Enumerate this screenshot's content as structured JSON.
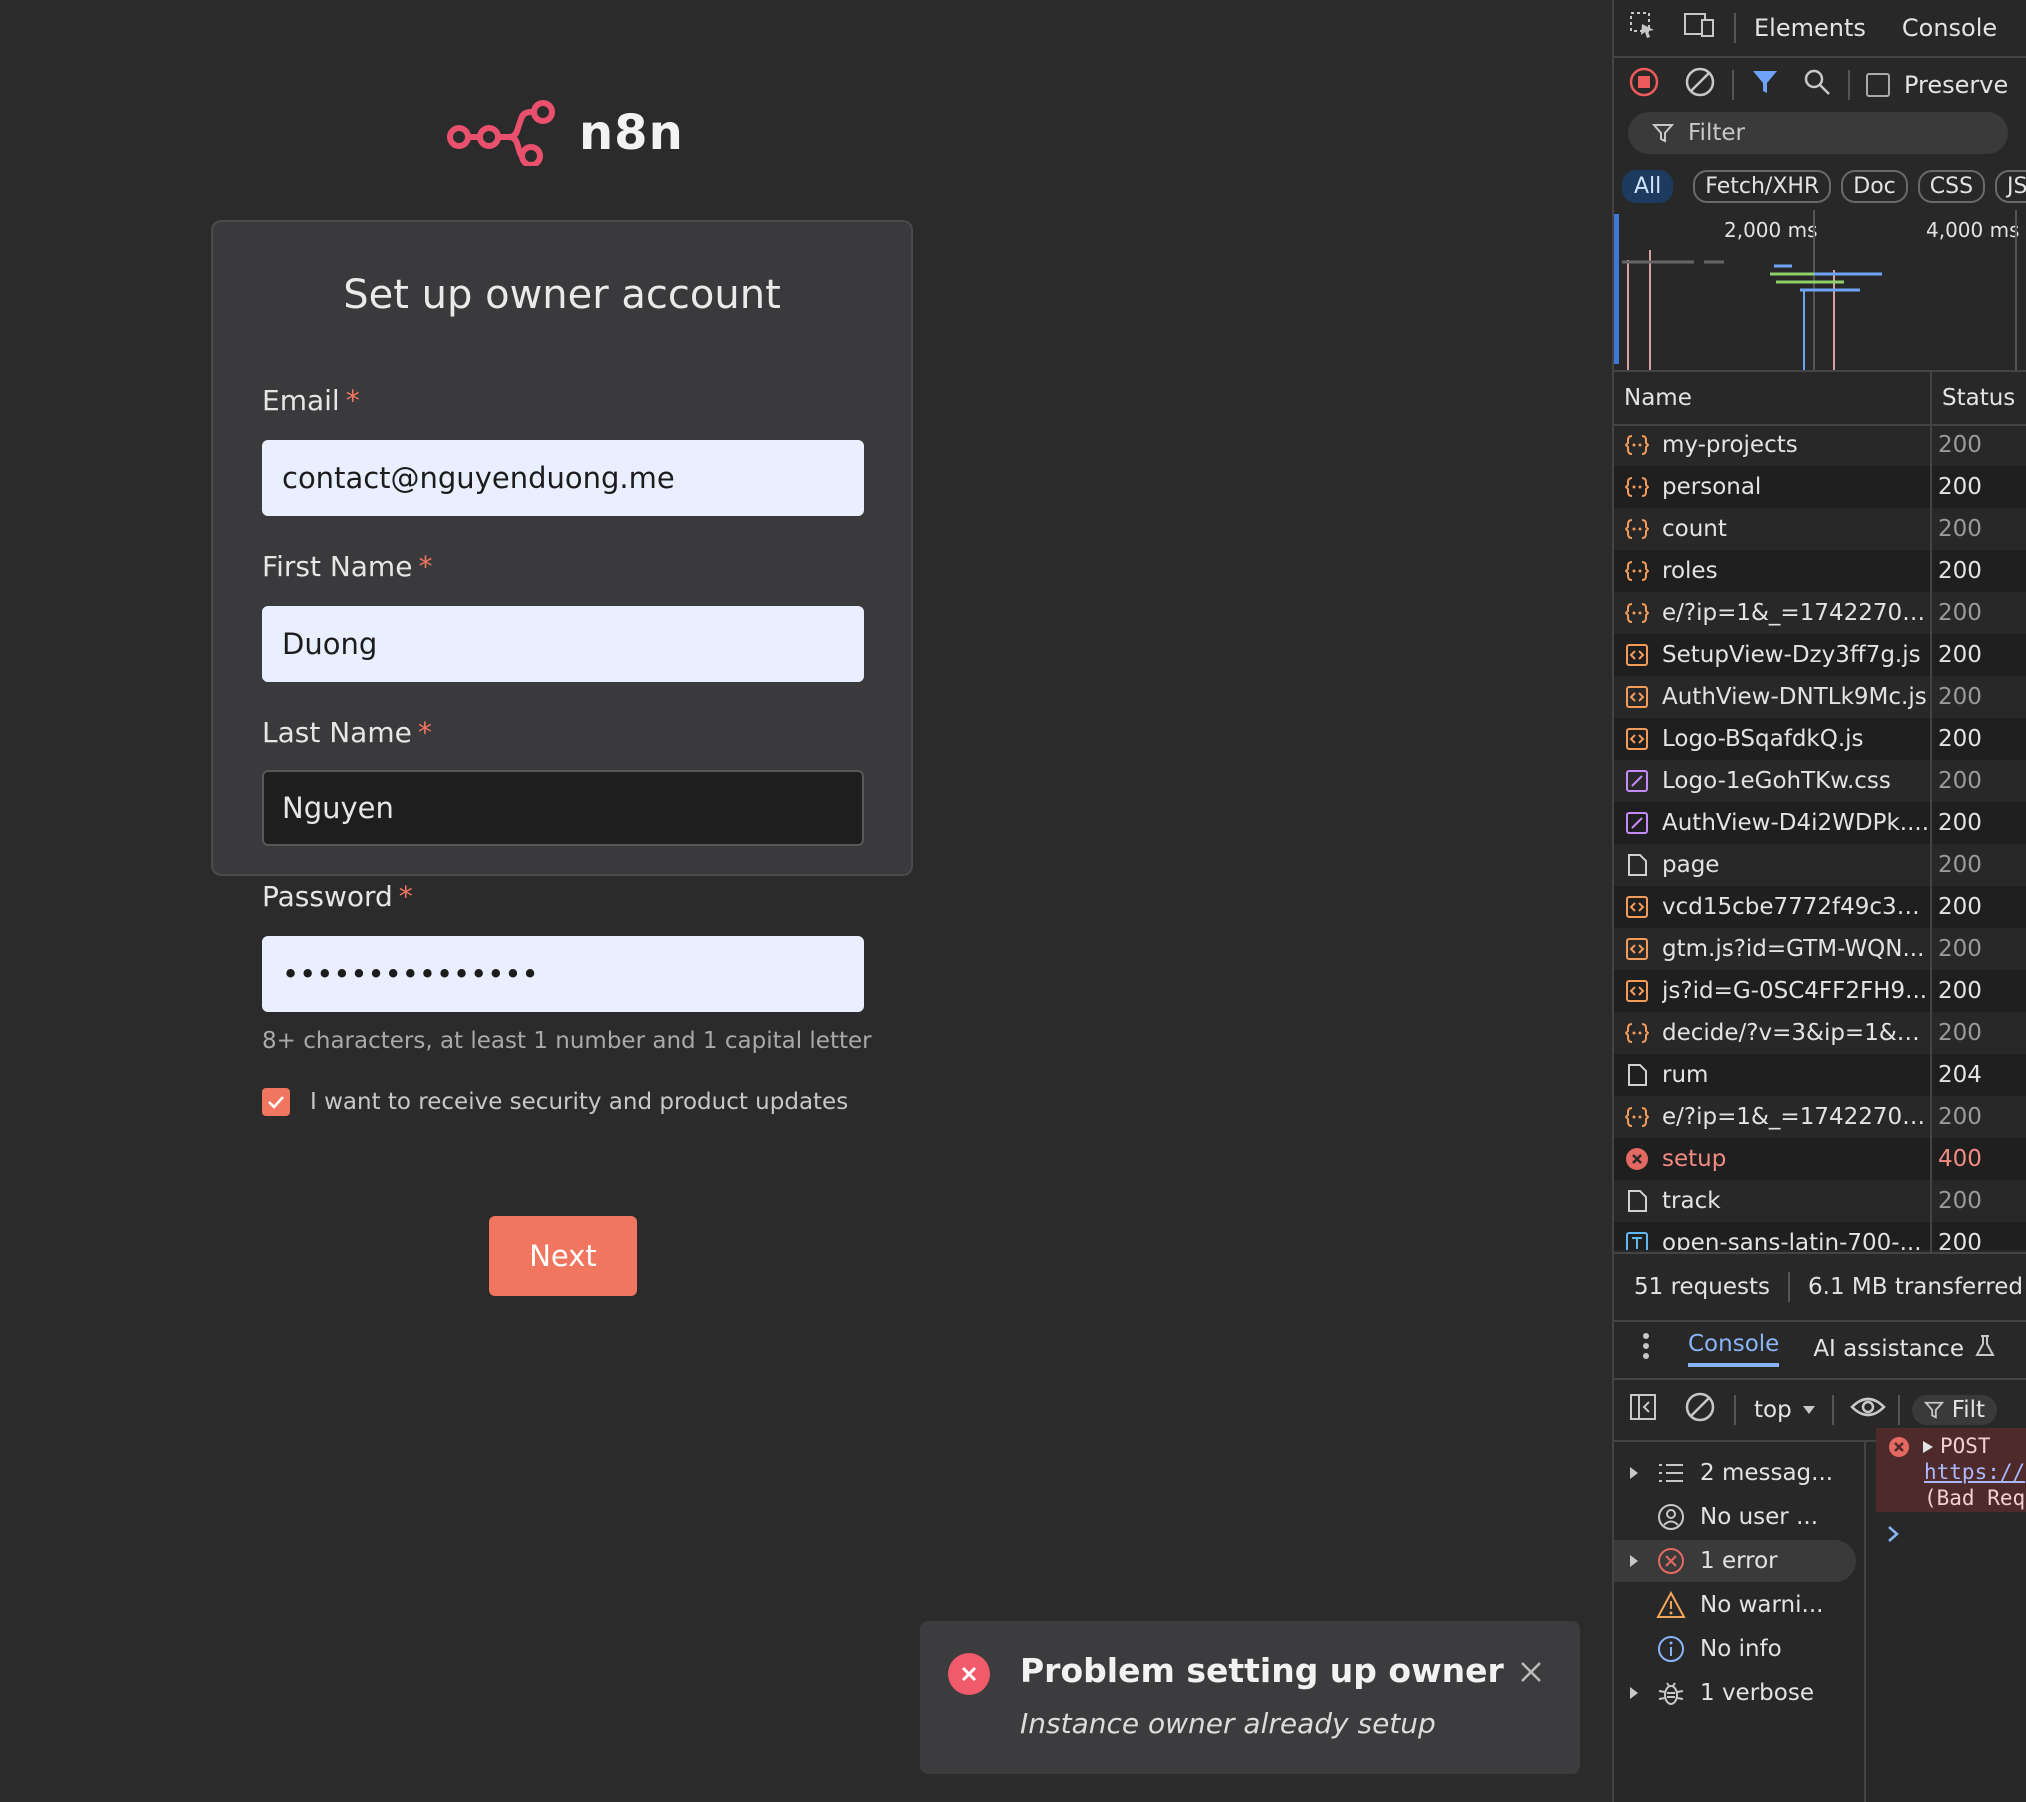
{
  "app": {
    "logo_text": "n8n",
    "card_title": "Set up owner account",
    "fields": {
      "email": {
        "label": "Email",
        "required_mark": "*",
        "value": "contact@nguyenduong.me"
      },
      "first_name": {
        "label": "First Name",
        "required_mark": "*",
        "value": "Duong"
      },
      "last_name": {
        "label": "Last Name",
        "required_mark": "*",
        "value": "Nguyen"
      },
      "password": {
        "label": "Password",
        "required_mark": "*",
        "value": "•••••••••••••••"
      }
    },
    "password_hint": "8+ characters, at least 1 number and 1 capital letter",
    "updates_checkbox": {
      "label": "I want to receive security and product updates",
      "checked": true
    },
    "next_label": "Next",
    "accent_color": "#f0765f"
  },
  "toast": {
    "title": "Problem setting up owner",
    "message": "Instance owner already setup",
    "icon": "error-icon"
  },
  "devtools": {
    "tabs": [
      "Elements",
      "Console"
    ],
    "preserve_label": "Preserve",
    "filter_placeholder": "Filter",
    "type_chips": [
      "All",
      "Fetch/XHR",
      "Doc",
      "CSS",
      "JS"
    ],
    "timeline_labels": [
      "2,000 ms",
      "4,000 ms"
    ],
    "columns": {
      "name": "Name",
      "status": "Status"
    },
    "requests": [
      {
        "icon": "xhr",
        "name": "my-projects",
        "status": "200"
      },
      {
        "icon": "xhr",
        "name": "personal",
        "status": "200"
      },
      {
        "icon": "xhr",
        "name": "count",
        "status": "200"
      },
      {
        "icon": "xhr",
        "name": "roles",
        "status": "200"
      },
      {
        "icon": "xhr",
        "name": "e/?ip=1&_=17422700...",
        "status": "200"
      },
      {
        "icon": "script",
        "name": "SetupView-Dzy3ff7g.js",
        "status": "200"
      },
      {
        "icon": "script",
        "name": "AuthView-DNTLk9Mc.js",
        "status": "200"
      },
      {
        "icon": "script",
        "name": "Logo-BSqafdkQ.js",
        "status": "200"
      },
      {
        "icon": "css",
        "name": "Logo-1eGohTKw.css",
        "status": "200"
      },
      {
        "icon": "css",
        "name": "AuthView-D4i2WDPk....",
        "status": "200"
      },
      {
        "icon": "doc",
        "name": "page",
        "status": "200"
      },
      {
        "icon": "script",
        "name": "vcd15cbe7772f49c39...",
        "status": "200"
      },
      {
        "icon": "script",
        "name": "gtm.js?id=GTM-WQN...",
        "status": "200"
      },
      {
        "icon": "script",
        "name": "js?id=G-0SC4FF2FH9...",
        "status": "200"
      },
      {
        "icon": "xhr",
        "name": "decide/?v=3&ip=1&_=...",
        "status": "200"
      },
      {
        "icon": "doc",
        "name": "rum",
        "status": "204"
      },
      {
        "icon": "xhr",
        "name": "e/?ip=1&_=17422700...",
        "status": "200"
      },
      {
        "icon": "error",
        "name": "setup",
        "status": "400"
      },
      {
        "icon": "doc",
        "name": "track",
        "status": "200"
      },
      {
        "icon": "font",
        "name": "open-sans-latin-700-...",
        "status": "200"
      }
    ],
    "summary": {
      "requests": "51 requests",
      "transferred": "6.1 MB transferred"
    },
    "console_tabs": [
      "Console",
      "AI assistance"
    ],
    "context": "top",
    "filter_short": "Filt",
    "sidebar": [
      {
        "icon": "list-icon",
        "label": "2 messag...",
        "expandable": true
      },
      {
        "icon": "user-icon",
        "label": "No user ...",
        "expandable": false
      },
      {
        "icon": "error-icon",
        "label": "1 error",
        "expandable": true
      },
      {
        "icon": "warning-icon",
        "label": "No warni...",
        "expandable": false
      },
      {
        "icon": "info-icon",
        "label": "No info",
        "expandable": false
      },
      {
        "icon": "bug-icon",
        "label": "1 verbose",
        "expandable": true
      }
    ],
    "console_message": {
      "method": "POST",
      "url": "https://",
      "status": "(Bad Req"
    }
  }
}
